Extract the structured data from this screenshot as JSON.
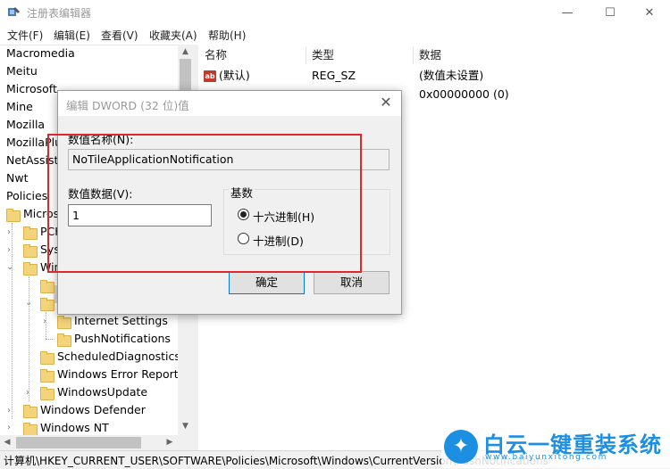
{
  "window": {
    "title": "注册表编辑器",
    "minimize": "—",
    "maximize": "☐",
    "close": "✕"
  },
  "menu": [
    "文件(F)",
    "编辑(E)",
    "查看(V)",
    "收藏夹(A)",
    "帮助(H)"
  ],
  "tree": {
    "top_items": [
      "Macromedia",
      "Meitu",
      "Microsoft",
      "Mine",
      "Mozilla",
      "MozillaPlu",
      "NetAssista",
      "Nwt",
      "Policies"
    ],
    "microsoft": "Micros",
    "children_partial": [
      "PCH",
      "Sys",
      "Win"
    ],
    "internet_settings": "Internet Settings",
    "push_notifications": "PushNotifications",
    "scheduled": "ScheduledDiagnostics",
    "wer": "Windows Error Reporti",
    "wu": "WindowsUpdate",
    "defender": "Windows Defender",
    "nt": "Windows NT"
  },
  "values": {
    "headers": {
      "name": "名称",
      "type": "类型",
      "data": "数据"
    },
    "rows": [
      {
        "name": "(默认)",
        "type": "REG_SZ",
        "data": "(数值未设置)"
      },
      {
        "name": "",
        "type": "",
        "data": "0x00000000 (0)"
      }
    ],
    "ab_icon": "ab"
  },
  "status": {
    "path": "计算机\\HKEY_CURRENT_USER\\SOFTWARE\\Policies\\Microsoft\\Windows\\CurrentVersion\\PushNotifications"
  },
  "dialog": {
    "title": "编辑 DWORD (32 位)值",
    "close": "✕",
    "name_label": "数值名称(N):",
    "name_value": "NoTileApplicationNotification",
    "data_label": "数值数据(V):",
    "data_value": "1",
    "base_label": "基数",
    "radio_hex": "十六进制(H)",
    "radio_dec": "十进制(D)",
    "selected_base": "hex",
    "ok": "确定",
    "cancel": "取消"
  },
  "watermark": {
    "title": "白云一键重装系统",
    "url": "www.baiyunxitong.com"
  },
  "colors": {
    "highlight": "#e0262f",
    "folder": "#f3d47a",
    "brand": "#1c8fe3"
  }
}
